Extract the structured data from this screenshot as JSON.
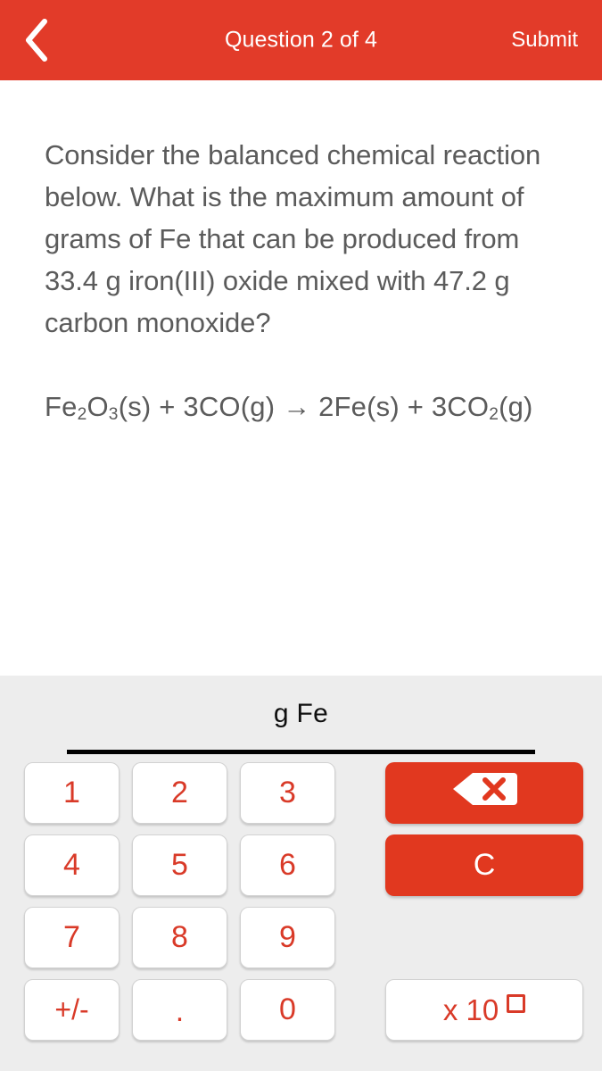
{
  "header": {
    "back_icon": "chevron-left-icon",
    "title": "Question 2 of 4",
    "submit_label": "Submit",
    "background_color": "#E23B29",
    "text_color": "#FFFFFF"
  },
  "question": {
    "prompt": "Consider the balanced chemical reaction below.  What is the maximum amount of grams of Fe that can be produced from 33.4 g iron(III) oxide mixed with 47.2 g carbon monoxide?",
    "equation_plain": "Fe2O3(s) + 3CO(g) → 2Fe(s) + 3CO2(g)",
    "equation_parts": {
      "reactant1_formula": "Fe",
      "reactant1_sub1": "2",
      "reactant1_elem2": "O",
      "reactant1_sub2": "3",
      "reactant1_state": "(s)",
      "plus1": "+",
      "reactant2": "3CO",
      "reactant2_state": "(g)",
      "arrow": "→",
      "product1": "2Fe",
      "product1_state": "(s)",
      "plus2": "+",
      "product2": "3CO",
      "product2_sub": "2",
      "product2_state": "(g)"
    },
    "text_color": "#5B5B5B"
  },
  "answer": {
    "unit_label": "g Fe",
    "value": "",
    "placeholder": ""
  },
  "keypad": {
    "background_color": "#EDEDED",
    "key_text_color": "#D93A28",
    "action_color": "#E1381F",
    "digits": [
      {
        "key": "1",
        "label": "1"
      },
      {
        "key": "2",
        "label": "2"
      },
      {
        "key": "3",
        "label": "3"
      },
      {
        "key": "4",
        "label": "4"
      },
      {
        "key": "5",
        "label": "5"
      },
      {
        "key": "6",
        "label": "6"
      },
      {
        "key": "7",
        "label": "7"
      },
      {
        "key": "8",
        "label": "8"
      },
      {
        "key": "9",
        "label": "9"
      },
      {
        "key": "sign",
        "label": "+/-"
      },
      {
        "key": "decimal",
        "label": "."
      },
      {
        "key": "0",
        "label": "0"
      }
    ],
    "actions": {
      "backspace_icon": "backspace-icon",
      "clear_label": "C",
      "exponent_label": "x 10"
    }
  }
}
